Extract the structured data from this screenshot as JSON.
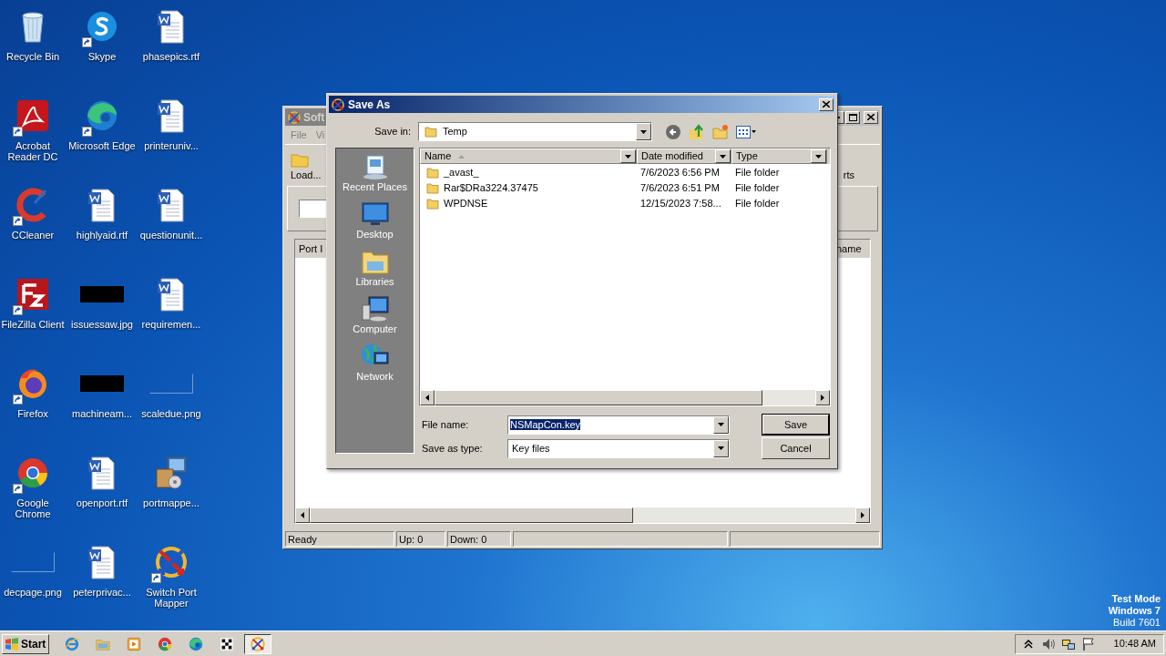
{
  "desktop": {
    "icons": [
      {
        "label": "Recycle Bin",
        "kind": "bin",
        "shortcut": false
      },
      {
        "label": "Skype",
        "kind": "skype",
        "shortcut": true
      },
      {
        "label": "phasepics.rtf",
        "kind": "doc",
        "shortcut": false
      },
      {
        "label": "Acrobat Reader DC",
        "kind": "acrobat",
        "shortcut": true
      },
      {
        "label": "Microsoft Edge",
        "kind": "edge",
        "shortcut": true
      },
      {
        "label": "printeruniv...",
        "kind": "doc",
        "shortcut": false
      },
      {
        "label": "CCleaner",
        "kind": "ccleaner",
        "shortcut": true
      },
      {
        "label": "highlyaid.rtf",
        "kind": "doc",
        "shortcut": false
      },
      {
        "label": "questionunit...",
        "kind": "doc",
        "shortcut": false
      },
      {
        "label": "FileZilla Client",
        "kind": "filezilla",
        "shortcut": true
      },
      {
        "label": "issuessaw.jpg",
        "kind": "image-black",
        "shortcut": false
      },
      {
        "label": "requiremen...",
        "kind": "doc",
        "shortcut": false
      },
      {
        "label": "Firefox",
        "kind": "firefox",
        "shortcut": true
      },
      {
        "label": "machineam...",
        "kind": "image-black",
        "shortcut": false
      },
      {
        "label": "scaledue.png",
        "kind": "image-blank",
        "shortcut": false
      },
      {
        "label": "Google Chrome",
        "kind": "chrome",
        "shortcut": true
      },
      {
        "label": "openport.rtf",
        "kind": "doc",
        "shortcut": false
      },
      {
        "label": "portmappe...",
        "kind": "installer",
        "shortcut": false
      },
      {
        "label": "decpage.png",
        "kind": "image-blank",
        "shortcut": false
      },
      {
        "label": "peterprivac...",
        "kind": "doc",
        "shortcut": false
      },
      {
        "label": "Switch Port Mapper",
        "kind": "portmapper",
        "shortcut": true
      }
    ],
    "system_notice": [
      "Test Mode",
      "Windows 7",
      "Build 7601"
    ]
  },
  "app_window": {
    "title": "Soft",
    "menu": [
      "File",
      "Vi"
    ],
    "toolbar": [
      "Load...",
      "rts"
    ],
    "columns": [
      "Port I",
      "name"
    ],
    "status": [
      "Ready",
      "Up: 0",
      "Down: 0"
    ]
  },
  "save_dialog": {
    "title": "Save As",
    "save_in_label": "Save in:",
    "save_in": "Temp",
    "places": [
      {
        "label": "Recent Places",
        "kind": "recent"
      },
      {
        "label": "Desktop",
        "kind": "desktop"
      },
      {
        "label": "Libraries",
        "kind": "libraries"
      },
      {
        "label": "Computer",
        "kind": "computer"
      },
      {
        "label": "Network",
        "kind": "network"
      }
    ],
    "columns": [
      {
        "label": "Name",
        "sorted": true
      },
      {
        "label": "Date modified",
        "sorted": false
      },
      {
        "label": "Type",
        "sorted": false
      }
    ],
    "rows": [
      {
        "name": "_avast_",
        "date": "7/6/2023 6:56 PM",
        "type": "File folder"
      },
      {
        "name": "Rar$DRa3224.37475",
        "date": "7/6/2023 6:51 PM",
        "type": "File folder"
      },
      {
        "name": "WPDNSE",
        "date": "12/15/2023 7:58...",
        "type": "File folder"
      }
    ],
    "file_name_label": "File name:",
    "file_name": "NSMapCon.key",
    "file_name_selected": true,
    "type_label": "Save as type:",
    "type": "Key files",
    "buttons": [
      "Save",
      "Cancel"
    ]
  },
  "taskbar": {
    "start": "Start",
    "apps": [
      {
        "kind": "ie",
        "active": false
      },
      {
        "kind": "explorer",
        "active": false
      },
      {
        "kind": "media",
        "active": false
      },
      {
        "kind": "chrome",
        "active": false
      },
      {
        "kind": "edge",
        "active": false
      },
      {
        "kind": "grid",
        "active": false
      },
      {
        "kind": "portmapper",
        "active": true
      }
    ],
    "clock": "10:48 AM"
  }
}
